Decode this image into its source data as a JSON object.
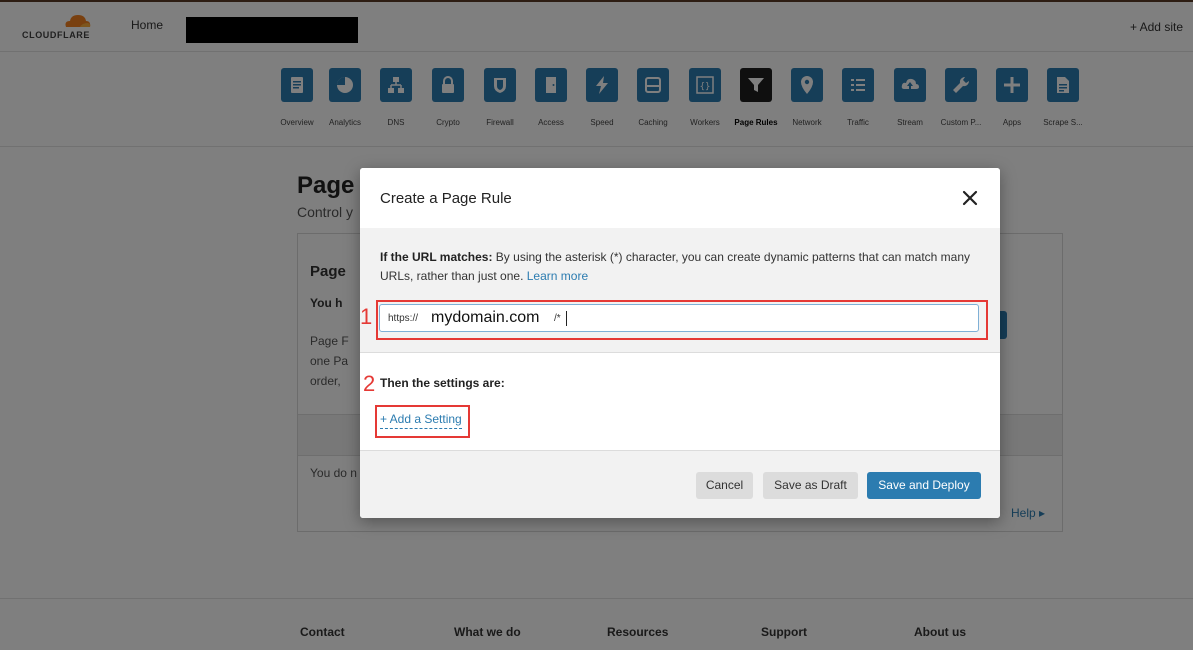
{
  "header": {
    "logo_text": "CLOUDFLARE",
    "home_label": "Home",
    "add_site_label": "+ Add site"
  },
  "apps": [
    {
      "label": "Overview",
      "icon": "overview-icon"
    },
    {
      "label": "Analytics",
      "icon": "analytics-icon"
    },
    {
      "label": "DNS",
      "icon": "dns-icon"
    },
    {
      "label": "Crypto",
      "icon": "lock-icon"
    },
    {
      "label": "Firewall",
      "icon": "shield-icon"
    },
    {
      "label": "Access",
      "icon": "door-icon"
    },
    {
      "label": "Speed",
      "icon": "lightning-icon"
    },
    {
      "label": "Caching",
      "icon": "drive-icon"
    },
    {
      "label": "Workers",
      "icon": "braces-icon"
    },
    {
      "label": "Page Rules",
      "icon": "filter-icon",
      "active": true
    },
    {
      "label": "Network",
      "icon": "location-pin-icon"
    },
    {
      "label": "Traffic",
      "icon": "list-icon"
    },
    {
      "label": "Stream",
      "icon": "cloud-upload-icon"
    },
    {
      "label": "Custom P...",
      "icon": "wrench-icon"
    },
    {
      "label": "Apps",
      "icon": "plus-icon"
    },
    {
      "label": "Scrape S...",
      "icon": "document-icon"
    }
  ],
  "background": {
    "title": "Page",
    "subtitle": "Control y",
    "card_title": "Page",
    "card_bold": "You h",
    "line1": "Page F",
    "line2": "one Pa",
    "line3": "order,",
    "empty_text": "You do n",
    "help_label": "Help ▸"
  },
  "footer": {
    "contact": "Contact",
    "what_we_do": "What we do",
    "resources": "Resources",
    "support": "Support",
    "about": "About us"
  },
  "modal": {
    "title": "Create a Page Rule",
    "intro_bold": "If the URL matches:",
    "intro_text": " By using the asterisk (*) character, you can create dynamic patterns that can match many URLs, rather than just one. ",
    "learn_more": "Learn more",
    "url_prefix": "https://",
    "url_domain": "mydomain.com",
    "url_suffix": "/*",
    "settings_label": "Then the settings are:",
    "add_setting": "+ Add a Setting",
    "cancel": "Cancel",
    "save_draft": "Save as Draft",
    "save_deploy": "Save and Deploy"
  },
  "annotations": {
    "marker1": "1",
    "marker2": "2"
  },
  "colors": {
    "accent": "#2c7cb0",
    "annotation": "#e53935",
    "active_app": "#1f1f1f"
  }
}
